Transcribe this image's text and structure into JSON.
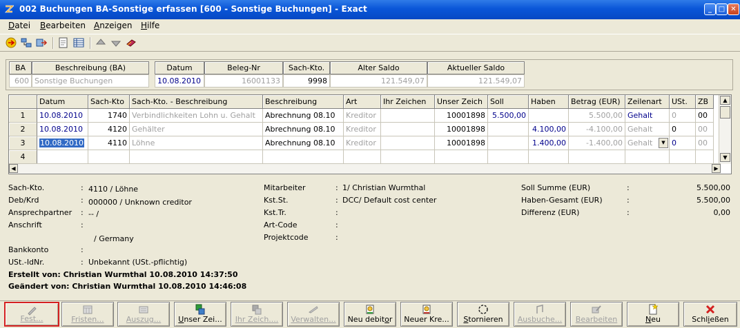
{
  "window": {
    "title": "002 Buchungen BA-Sonstige erfassen [600 - Sonstige Buchungen] - Exact",
    "app_icon": "exact-app-icon"
  },
  "menu": [
    {
      "label": "Datei",
      "mn": "D",
      "rest": "atei"
    },
    {
      "label": "Bearbeiten",
      "mn": "B",
      "rest": "earbeiten"
    },
    {
      "label": "Anzeigen",
      "mn": "A",
      "rest": "nzeigen"
    },
    {
      "label": "Hilfe",
      "mn": "H",
      "rest": "ilfe"
    }
  ],
  "toolbar": [
    "exact-logo-icon",
    "transfer-icon",
    "export-icon",
    "document-icon",
    "table-icon",
    "arrow-up-icon",
    "arrow-down-icon",
    "book-icon"
  ],
  "header": {
    "labels": {
      "ba": "BA",
      "beschreibung": "Beschreibung (BA)",
      "datum": "Datum",
      "belegnr": "Beleg-Nr",
      "sachkto": "Sach-Kto.",
      "alter_saldo": "Alter Saldo",
      "aktueller_saldo": "Aktueller Saldo"
    },
    "values": {
      "ba": "600",
      "beschreibung": "Sonstige Buchungen",
      "datum": "10.08.2010",
      "belegnr": "16001133",
      "sachkto": "9998",
      "alter_saldo": "121.549,07",
      "aktueller_saldo": "121.549,07"
    }
  },
  "grid": {
    "columns": [
      "Datum",
      "Sach-Kto",
      "Sach-Kto. - Beschreibung",
      "Beschreibung",
      "Art",
      "Ihr Zeichen",
      "Unser Zeich",
      "Soll",
      "Haben",
      "Betrag (EUR)",
      "Zeilenart",
      "USt.",
      "ZB"
    ],
    "rows": [
      {
        "num": "1",
        "datum": "10.08.2010",
        "kto": "1740",
        "ktobeschr": "Verbindlichkeiten Lohn u. Gehalt",
        "beschr": "Abrechnung 08.10",
        "art": "Kreditor",
        "ihr": "",
        "unser": "10001898",
        "soll": "5.500,00",
        "haben": "",
        "betrag": "5.500,00",
        "zeilenart": "Gehalt",
        "ust": "0",
        "zb": "00"
      },
      {
        "num": "2",
        "datum": "10.08.2010",
        "kto": "4120",
        "ktobeschr": "Gehälter",
        "beschr": "Abrechnung 08.10",
        "art": "Kreditor",
        "ihr": "",
        "unser": "10001898",
        "soll": "",
        "haben": "4.100,00",
        "betrag": "-4.100,00",
        "zeilenart": "Gehalt",
        "ust": "0",
        "zb": "00"
      },
      {
        "num": "3",
        "datum": "10.08.2010",
        "kto": "4110",
        "ktobeschr": "Löhne",
        "beschr": "Abrechnung 08.10",
        "art": "Kreditor",
        "ihr": "",
        "unser": "10001898",
        "soll": "",
        "haben": "1.400,00",
        "betrag": "-1.400,00",
        "zeilenart": "Gehalt",
        "ust": "0",
        "zb": "00"
      },
      {
        "num": "4",
        "datum": "",
        "kto": "",
        "ktobeschr": "",
        "beschr": "",
        "art": "",
        "ihr": "",
        "unser": "",
        "soll": "",
        "haben": "",
        "betrag": "",
        "zeilenart": "",
        "ust": "",
        "zb": ""
      }
    ]
  },
  "details": {
    "sachkto_label": "Sach-Kto.",
    "sachkto_value": "4110 / Löhne",
    "debkrd_label": "Deb/Krd",
    "debkrd_value": "000000 / Unknown creditor",
    "ansprech_label": "Ansprechpartner",
    "ansprech_value": "-- /",
    "anschrift_label": "Anschrift",
    "anschrift_value": "",
    "country_value": "/ Germany",
    "bank_label": "Bankkonto",
    "bank_value": "",
    "ust_label": "USt.-IdNr.",
    "ust_value": "Unbekannt (USt.-pflichtig)",
    "erstellt": "Erstellt von: Christian Wurmthal  10.08.2010 14:37:50",
    "geaendert": "Geändert von: Christian Wurmthal  10.08.2010 14:46:08",
    "mitarbeiter_label": "Mitarbeiter",
    "mitarbeiter_value": "1/ Christian Wurmthal",
    "kstst_label": "Kst.St.",
    "kstst_value": "DCC/ Default cost center",
    "ksttr_label": "Kst.Tr.",
    "ksttr_value": "",
    "artcode_label": "Art-Code",
    "artcode_value": "",
    "projekt_label": "Projektcode",
    "projekt_value": "",
    "sollsumme_label": "Soll Summe (EUR)",
    "sollsumme_value": "5.500,00",
    "habengesamt_label": "Haben-Gesamt (EUR)",
    "habengesamt_value": "5.500,00",
    "differenz_label": "Differenz (EUR)",
    "differenz_value": "0,00",
    "colon": ":"
  },
  "buttons": [
    {
      "label": "Fest...",
      "icon": "pen-icon",
      "enabled": false,
      "focused": true
    },
    {
      "label": "Fristen...",
      "icon": "calendar-icon",
      "enabled": false
    },
    {
      "label": "Auszug...",
      "icon": "statement-icon",
      "enabled": false
    },
    {
      "label": "Unser Zei...",
      "icon": "add-line-icon",
      "enabled": true
    },
    {
      "label": "Ihr Zeich....",
      "icon": "reference-icon",
      "enabled": false
    },
    {
      "label": "Verwalten...",
      "icon": "manage-icon",
      "enabled": false
    },
    {
      "label": "Neu debitor",
      "icon": "new-debtor-icon",
      "enabled": true
    },
    {
      "label": "Neuer Kre...",
      "icon": "new-creditor-icon",
      "enabled": true
    },
    {
      "label": "Stornieren",
      "icon": "cancel-circle-icon",
      "enabled": true
    },
    {
      "label": "Ausbuche...",
      "icon": "write-off-icon",
      "enabled": false
    },
    {
      "label": "Bearbeiten",
      "icon": "edit-icon",
      "enabled": false
    },
    {
      "label": "Neu",
      "icon": "new-document-icon",
      "enabled": true
    },
    {
      "label": "Schließen",
      "icon": "close-x-icon",
      "enabled": true
    }
  ]
}
